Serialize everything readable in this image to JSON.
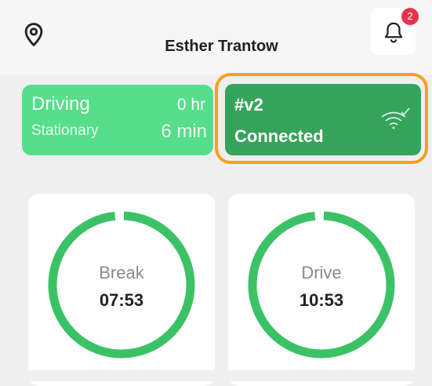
{
  "header": {
    "title": "Esther Trantow",
    "location_icon": "map-pin-icon",
    "notification_icon": "bell-icon",
    "notification_count": "2"
  },
  "status_card": {
    "driving_label": "Driving",
    "driving_value": "0 hr",
    "stationary_label": "Stationary",
    "stationary_value": "6 min"
  },
  "device_card": {
    "id": "#v2",
    "status": "Connected",
    "icon": "wifi-connected-icon",
    "highlight_color": "#f4a21c"
  },
  "timers": [
    {
      "label": "Break",
      "value": "07:53",
      "progress": 0.99
    },
    {
      "label": "Drive",
      "value": "10:53",
      "progress": 0.99
    }
  ],
  "colors": {
    "driving_card": "#56de8a",
    "device_card": "#35a45a",
    "ring": "#3cc266",
    "badge": "#e5344b"
  }
}
